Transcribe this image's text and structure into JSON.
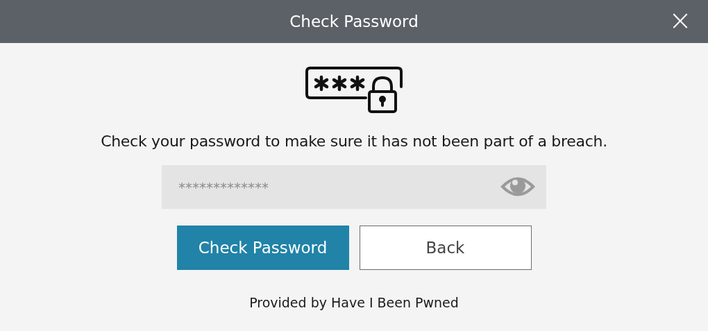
{
  "window": {
    "title": "Check Password",
    "close_label": "×"
  },
  "message": "Check your password to make sure it has not been part of a breach.",
  "password_field": {
    "placeholder": "*************"
  },
  "buttons": [
    {
      "label": "Check Password",
      "kind": "primary"
    },
    {
      "label": "Back",
      "kind": "secondary"
    }
  ],
  "footer": "Provided by Have I Been Pwned"
}
